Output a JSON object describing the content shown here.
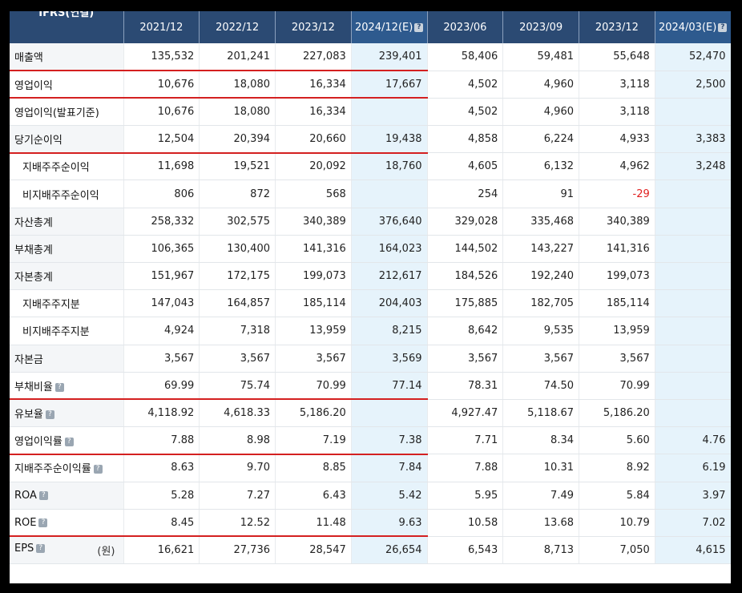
{
  "header": {
    "corner": "IFRS(연결)",
    "columns": [
      "2021/12",
      "2022/12",
      "2023/12",
      "2024/12(E)",
      "2023/06",
      "2023/09",
      "2023/12",
      "2024/03(E)"
    ]
  },
  "rows": [
    {
      "label": "매출액",
      "values": [
        "135,532",
        "201,241",
        "227,083",
        "239,401",
        "58,406",
        "59,481",
        "55,648",
        "52,470"
      ]
    },
    {
      "label": "영업이익",
      "values": [
        "10,676",
        "18,080",
        "16,334",
        "17,667",
        "4,502",
        "4,960",
        "3,118",
        "2,500"
      ]
    },
    {
      "label": "영업이익(발표기준)",
      "values": [
        "10,676",
        "18,080",
        "16,334",
        "",
        "4,502",
        "4,960",
        "3,118",
        ""
      ]
    },
    {
      "label": "당기순이익",
      "values": [
        "12,504",
        "20,394",
        "20,660",
        "19,438",
        "4,858",
        "6,224",
        "4,933",
        "3,383"
      ]
    },
    {
      "label": "지배주주순이익",
      "values": [
        "11,698",
        "19,521",
        "20,092",
        "18,760",
        "4,605",
        "6,132",
        "4,962",
        "3,248"
      ]
    },
    {
      "label": "비지배주주순이익",
      "values": [
        "806",
        "872",
        "568",
        "",
        "254",
        "91",
        "-29",
        ""
      ]
    },
    {
      "label": "자산총계",
      "values": [
        "258,332",
        "302,575",
        "340,389",
        "376,640",
        "329,028",
        "335,468",
        "340,389",
        ""
      ]
    },
    {
      "label": "부채총계",
      "values": [
        "106,365",
        "130,400",
        "141,316",
        "164,023",
        "144,502",
        "143,227",
        "141,316",
        ""
      ]
    },
    {
      "label": "자본총계",
      "values": [
        "151,967",
        "172,175",
        "199,073",
        "212,617",
        "184,526",
        "192,240",
        "199,073",
        ""
      ]
    },
    {
      "label": "지배주주지분",
      "values": [
        "147,043",
        "164,857",
        "185,114",
        "204,403",
        "175,885",
        "182,705",
        "185,114",
        ""
      ]
    },
    {
      "label": "비지배주주지분",
      "values": [
        "4,924",
        "7,318",
        "13,959",
        "8,215",
        "8,642",
        "9,535",
        "13,959",
        ""
      ]
    },
    {
      "label": "자본금",
      "values": [
        "3,567",
        "3,567",
        "3,567",
        "3,569",
        "3,567",
        "3,567",
        "3,567",
        ""
      ]
    },
    {
      "label": "부채비율",
      "values": [
        "69.99",
        "75.74",
        "70.99",
        "77.14",
        "78.31",
        "74.50",
        "70.99",
        ""
      ]
    },
    {
      "label": "유보율",
      "values": [
        "4,118.92",
        "4,618.33",
        "5,186.20",
        "",
        "4,927.47",
        "5,118.67",
        "5,186.20",
        ""
      ]
    },
    {
      "label": "영업이익률",
      "values": [
        "7.88",
        "8.98",
        "7.19",
        "7.38",
        "7.71",
        "8.34",
        "5.60",
        "4.76"
      ]
    },
    {
      "label": "지배주주순이익률",
      "values": [
        "8.63",
        "9.70",
        "8.85",
        "7.84",
        "7.88",
        "10.31",
        "8.92",
        "6.19"
      ]
    },
    {
      "label": "ROA",
      "values": [
        "5.28",
        "7.27",
        "6.43",
        "5.42",
        "5.95",
        "7.49",
        "5.84",
        "3.97"
      ]
    },
    {
      "label": "ROE",
      "values": [
        "8.45",
        "12.52",
        "11.48",
        "9.63",
        "10.58",
        "13.68",
        "10.79",
        "7.02"
      ]
    },
    {
      "label": "EPS",
      "unit": "(원)",
      "values": [
        "16,621",
        "27,736",
        "28,547",
        "26,654",
        "6,543",
        "8,713",
        "7,050",
        "4,615"
      ]
    }
  ],
  "colors": {
    "header_bg": "#2b4a73",
    "estimate_bg": "#e6f3fb",
    "negative": "#e02020",
    "underline": "#d42020"
  }
}
